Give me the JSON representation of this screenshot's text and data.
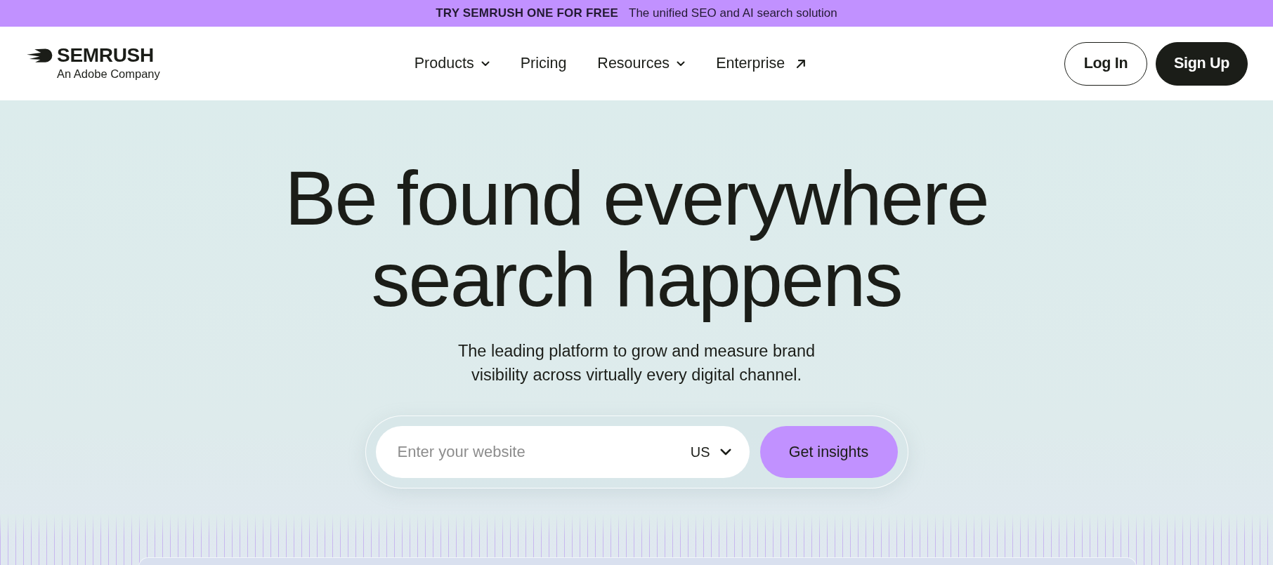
{
  "banner": {
    "headline": "TRY SEMRUSH ONE FOR FREE",
    "text": "The unified SEO and AI search solution"
  },
  "header": {
    "logo": {
      "wordmark": "SEMRUSH",
      "tagline": "An Adobe Company"
    },
    "nav": [
      {
        "label": "Products",
        "kind": "dropdown"
      },
      {
        "label": "Pricing",
        "kind": "link"
      },
      {
        "label": "Resources",
        "kind": "dropdown"
      },
      {
        "label": "Enterprise",
        "kind": "external"
      }
    ],
    "actions": [
      {
        "label": "Log In",
        "kind": "outline"
      },
      {
        "label": "Sign Up",
        "kind": "filled"
      }
    ]
  },
  "hero": {
    "title": "Be found everywhere search happens",
    "subtitle": "The leading platform to grow and measure brand visibility across virtually every digital channel."
  },
  "search": {
    "placeholder": "Enter your website",
    "country": "US",
    "button": "Get insights"
  }
}
